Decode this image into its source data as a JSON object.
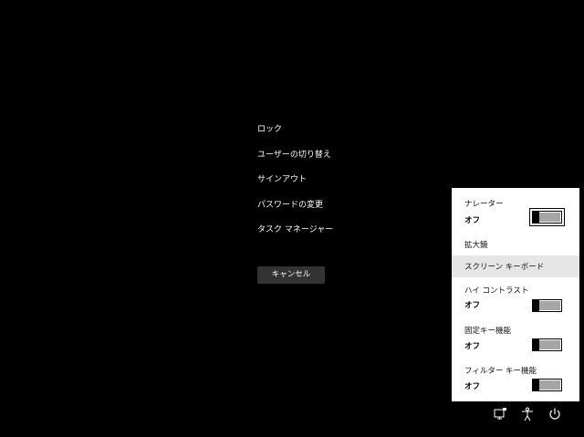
{
  "menu": {
    "items": [
      {
        "label": "ロック"
      },
      {
        "label": "ユーザーの切り替え"
      },
      {
        "label": "サインアウト"
      },
      {
        "label": "パスワードの変更"
      },
      {
        "label": "タスク マネージャー"
      }
    ],
    "cancel_label": "キャンセル"
  },
  "ease_of_access": {
    "items": [
      {
        "label": "ナレーター",
        "state": "オフ",
        "toggle_on": false
      },
      {
        "label": "拡大鏡"
      },
      {
        "label": "スクリーン キーボード",
        "highlighted": true
      },
      {
        "label": "ハイ コントラスト",
        "state": "オフ",
        "toggle_on": false
      },
      {
        "label": "固定キー機能",
        "state": "オフ",
        "toggle_on": false
      },
      {
        "label": "フィルター キー機能",
        "state": "オフ",
        "toggle_on": false
      }
    ]
  },
  "system_icons": [
    "network-icon",
    "ease-of-access-icon",
    "power-icon"
  ],
  "colors": {
    "background": "#000000",
    "panel": "#ffffff",
    "highlight": "#e6e6e6",
    "button": "#333333",
    "text_light": "#ffffff"
  }
}
